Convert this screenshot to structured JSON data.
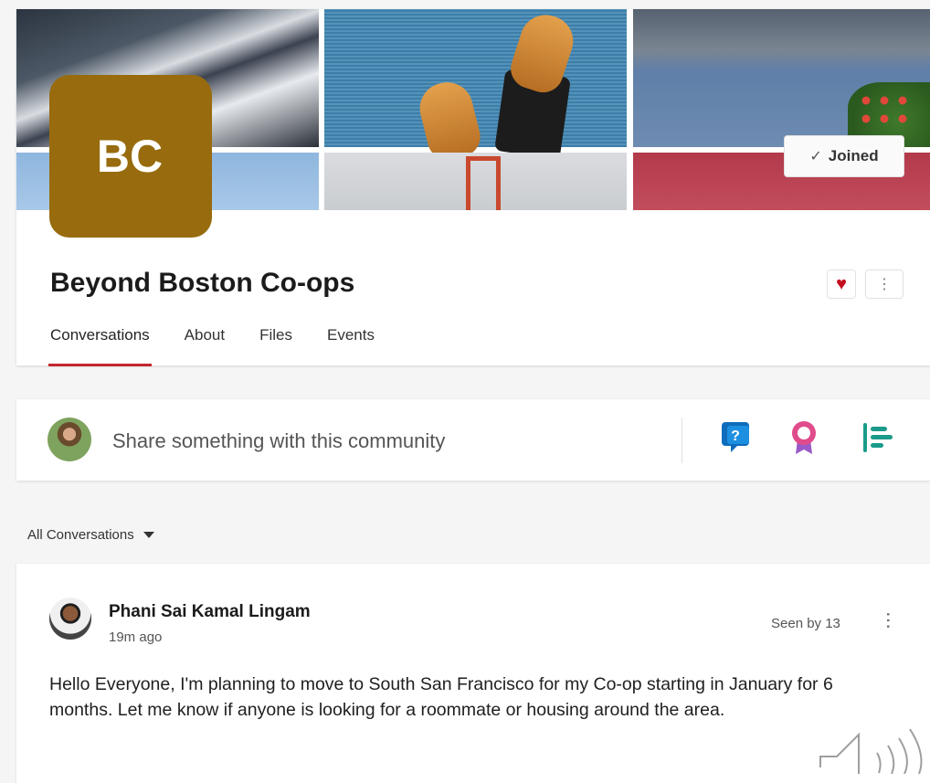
{
  "community": {
    "initials": "BC",
    "name": "Beyond Boston Co-ops",
    "joined_label": "Joined",
    "tabs": [
      {
        "label": "Conversations",
        "active": true
      },
      {
        "label": "About",
        "active": false
      },
      {
        "label": "Files",
        "active": false
      },
      {
        "label": "Events",
        "active": false
      }
    ],
    "accent_color": "#976b0e"
  },
  "composer": {
    "placeholder": "Share something with this community",
    "actions": [
      "question-icon",
      "praise-icon",
      "poll-icon"
    ]
  },
  "feed": {
    "filter_label": "All Conversations"
  },
  "post": {
    "author": "Phani Sai Kamal Lingam",
    "time": "19m ago",
    "seen": "Seen by 13",
    "body": "Hello Everyone, I'm planning to move to South San Francisco for my Co-op starting in January for 6 months. Let me know if anyone is looking for a roommate or housing around the area."
  }
}
